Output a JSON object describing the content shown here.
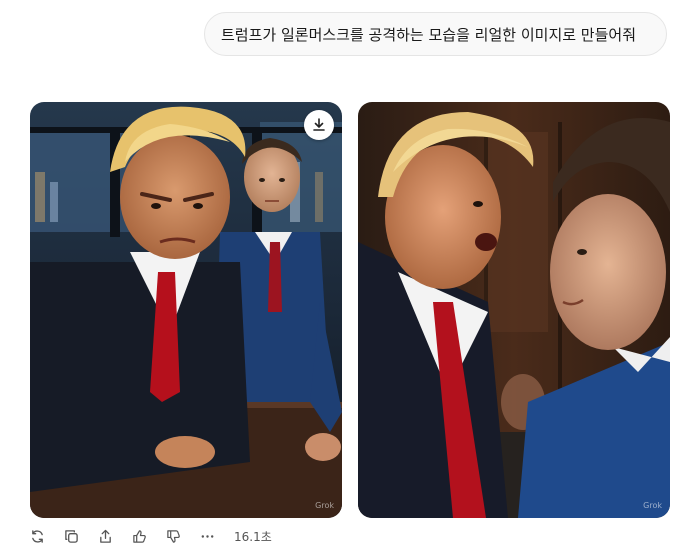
{
  "user_message": {
    "text": "트럼프가 일론머스크를 공격하는 모습을 리얼한 이미지로 만들어줘"
  },
  "images": [
    {
      "alt": "Trump leaning forward at a table, Musk standing behind",
      "watermark": "Grok",
      "download_icon": "download-icon"
    },
    {
      "alt": "Trump shouting at Musk face to face",
      "watermark": "Grok"
    }
  ],
  "actions": {
    "icons": [
      "regenerate-icon",
      "copy-icon",
      "share-icon",
      "thumbs-up-icon",
      "thumbs-down-icon",
      "more-icon"
    ],
    "elapsed": "16.1초"
  },
  "colors": {
    "bubble_bg": "#f9f9f9",
    "bubble_border": "#e5e5e5",
    "text": "#1a1a1a",
    "icon": "#555555"
  }
}
